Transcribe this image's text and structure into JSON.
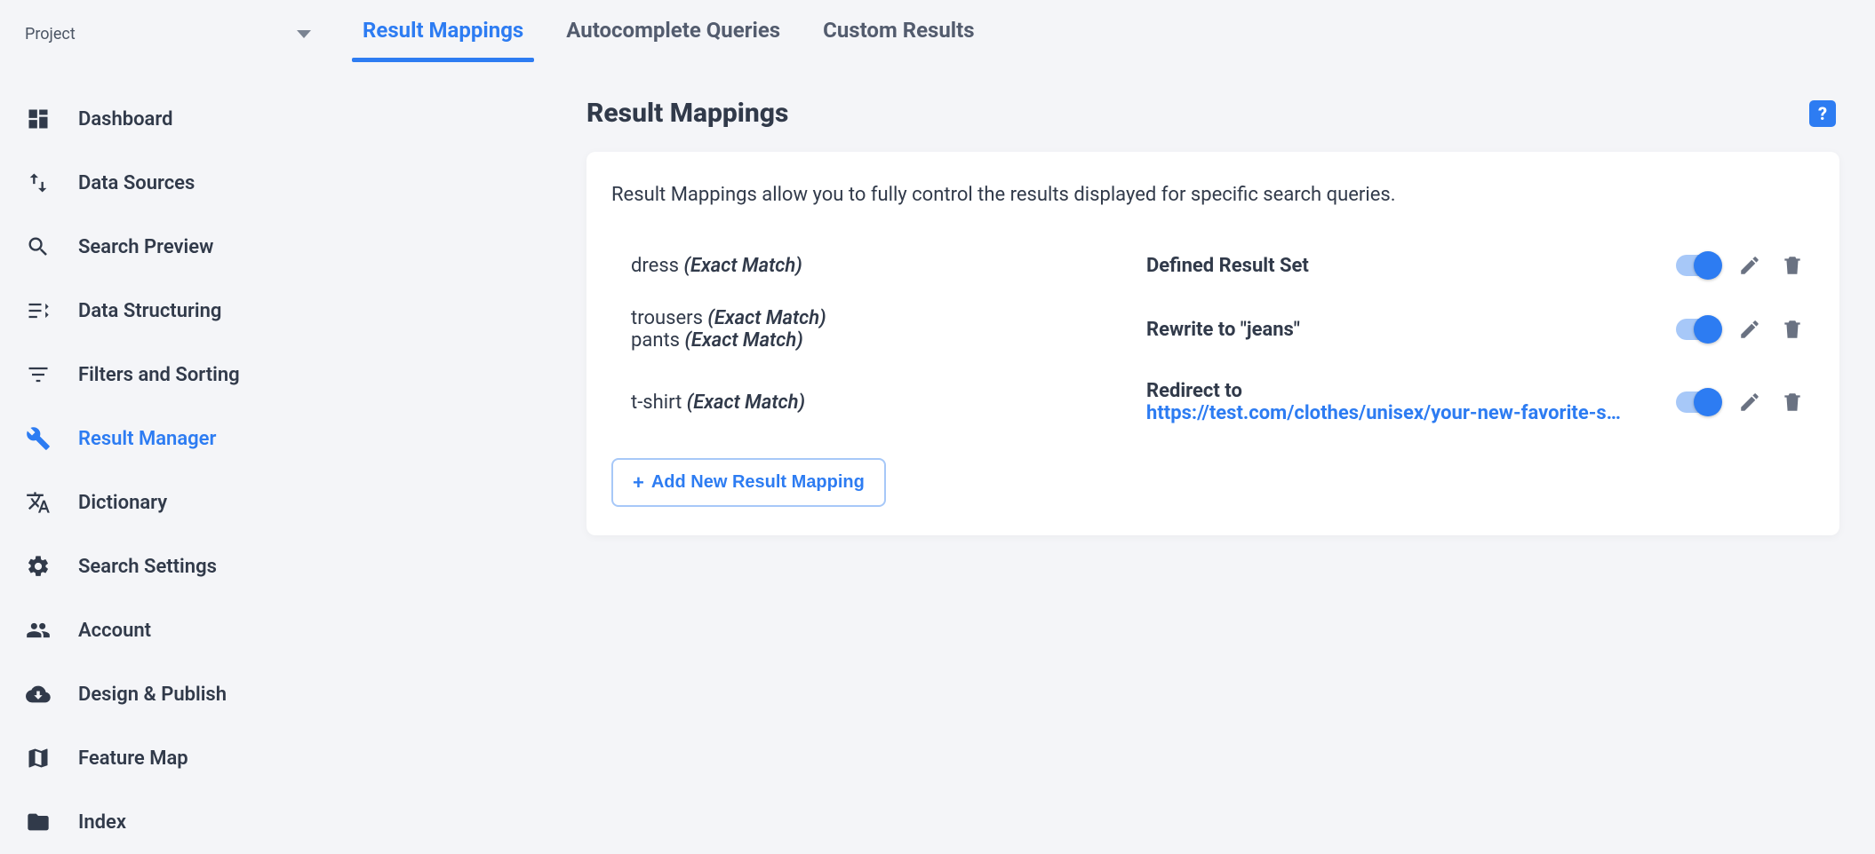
{
  "project": {
    "label": "Project"
  },
  "sidebar": {
    "items": [
      {
        "label": "Dashboard",
        "icon": "dashboard-icon"
      },
      {
        "label": "Data Sources",
        "icon": "data-sources-icon"
      },
      {
        "label": "Search Preview",
        "icon": "search-icon"
      },
      {
        "label": "Data Structuring",
        "icon": "structuring-icon"
      },
      {
        "label": "Filters and Sorting",
        "icon": "filters-icon"
      },
      {
        "label": "Result Manager",
        "icon": "tools-icon",
        "active": true
      },
      {
        "label": "Dictionary",
        "icon": "translate-icon"
      },
      {
        "label": "Search Settings",
        "icon": "gear-icon"
      },
      {
        "label": "Account",
        "icon": "people-icon"
      },
      {
        "label": "Design & Publish",
        "icon": "cloud-download-icon"
      },
      {
        "label": "Feature Map",
        "icon": "map-icon"
      },
      {
        "label": "Index",
        "icon": "folder-icon"
      }
    ]
  },
  "tabs": [
    {
      "label": "Result Mappings",
      "active": true
    },
    {
      "label": "Autocomplete Queries"
    },
    {
      "label": "Custom Results"
    }
  ],
  "page": {
    "title": "Result Mappings",
    "help": "?",
    "description": "Result Mappings allow you to fully control the results displayed for specific search queries."
  },
  "mappings": [
    {
      "terms": [
        {
          "text": "dress",
          "match": "(Exact Match)"
        }
      ],
      "action_text": "Defined Result Set",
      "enabled": true
    },
    {
      "terms": [
        {
          "text": "trousers",
          "match": "(Exact Match)"
        },
        {
          "text": "pants",
          "match": "(Exact Match)"
        }
      ],
      "action_text": "Rewrite to \"jeans\"",
      "enabled": true
    },
    {
      "terms": [
        {
          "text": "t-shirt",
          "match": "(Exact Match)"
        }
      ],
      "redirect_label": "Redirect to",
      "redirect_url": "https://test.com/clothes/unisex/your-new-favorite-s…",
      "enabled": true
    }
  ],
  "buttons": {
    "add": "Add New Result Mapping"
  }
}
